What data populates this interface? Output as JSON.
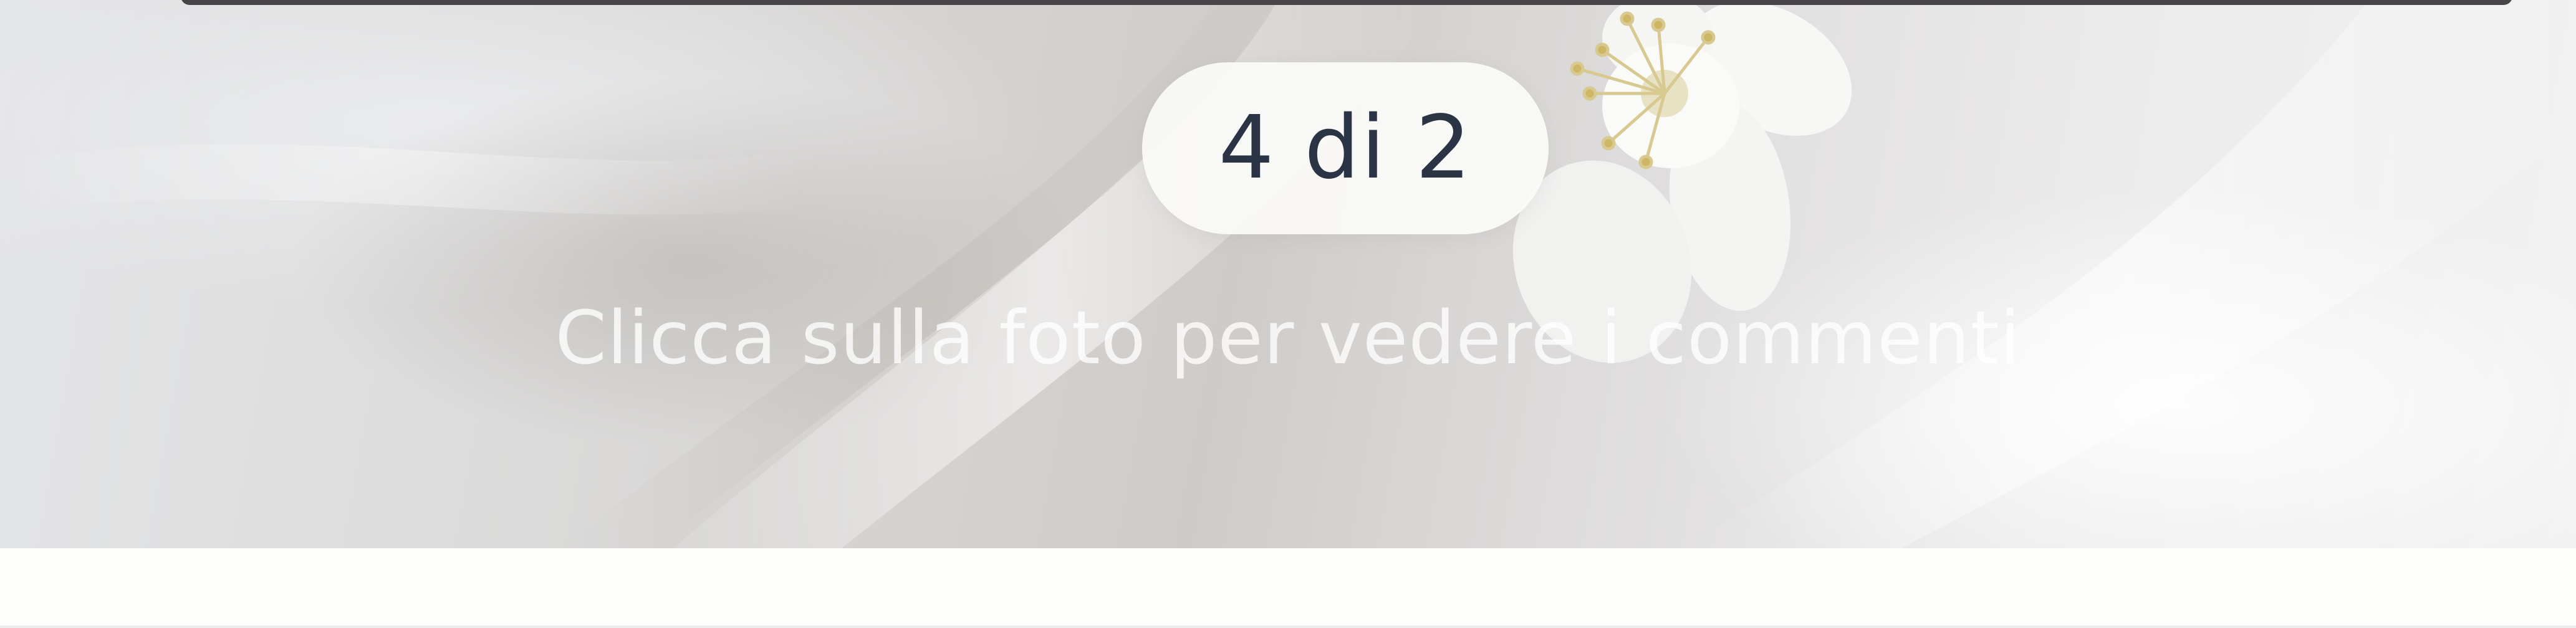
{
  "photo_viewer": {
    "counter": "4 di 2",
    "hint": "Clicca sulla foto per vedere i commenti"
  },
  "colors": {
    "counter_text": "#2b3445",
    "counter_background": "#fafaf9",
    "hint_text": "#ffffff",
    "frame_bar": "#474547"
  },
  "icons": {
    "background": "white-silk-with-flower-photo"
  }
}
